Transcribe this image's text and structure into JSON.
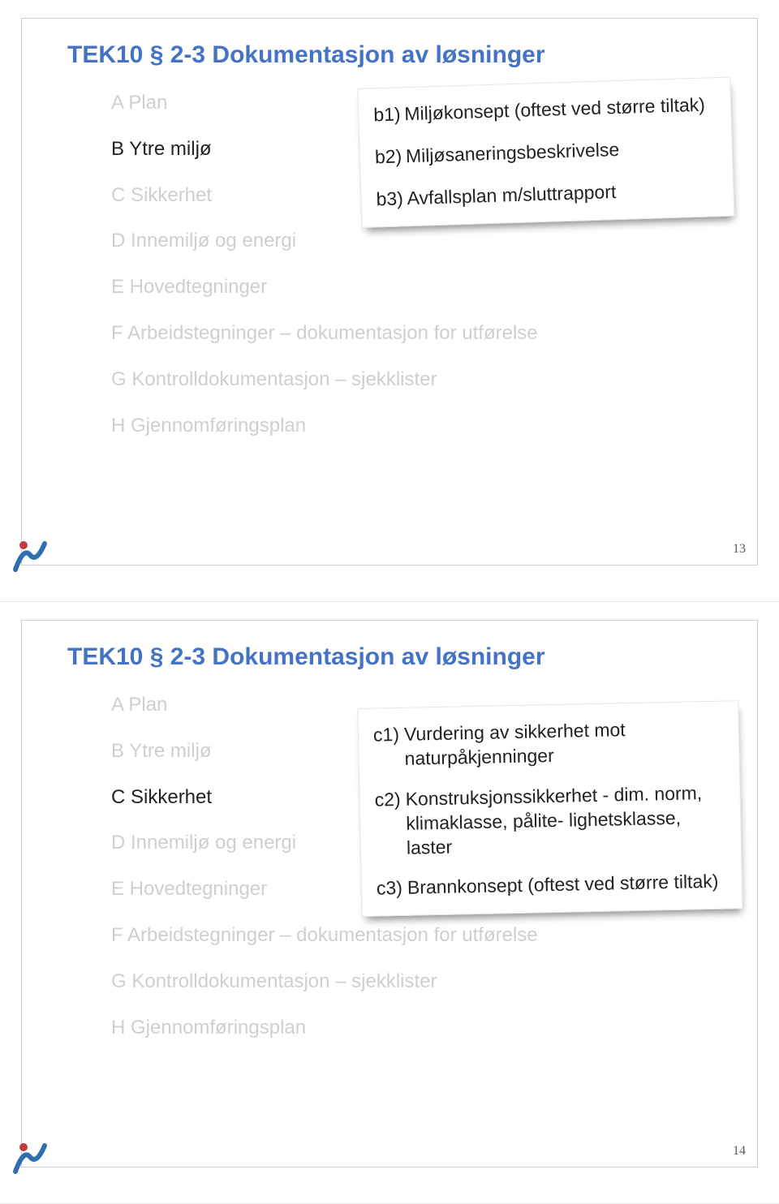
{
  "slide13": {
    "title": "TEK10 § 2-3 Dokumentasjon av løsninger",
    "pageNumber": "13",
    "items": {
      "a": "A Plan",
      "b": "B Ytre miljø",
      "c": "C Sikkerhet",
      "d": "D Innemiljø og energi",
      "e": "E Hovedtegninger",
      "f": "F Arbeidstegninger – dokumentasjon for utførelse",
      "g": "G Kontrolldokumentasjon – sjekklister",
      "h": "H Gjennomføringsplan"
    },
    "note": {
      "b1": {
        "tag": "b1)",
        "text": "Miljøkonsept (oftest ved større tiltak)"
      },
      "b2": {
        "tag": "b2)",
        "text": "Miljøsaneringsbeskrivelse"
      },
      "b3": {
        "tag": "b3)",
        "text": "Avfallsplan m/sluttrapport"
      }
    }
  },
  "slide14": {
    "title": "TEK10 § 2-3 Dokumentasjon av løsninger",
    "pageNumber": "14",
    "items": {
      "a": "A Plan",
      "b": "B Ytre miljø",
      "c": "C Sikkerhet",
      "d": "D Innemiljø og energi",
      "e": "E Hovedtegninger",
      "f": "F Arbeidstegninger – dokumentasjon for utførelse",
      "g": "G Kontrolldokumentasjon – sjekklister",
      "h": "H Gjennomføringsplan"
    },
    "note": {
      "c1": {
        "tag": "c1)",
        "text": "Vurdering av sikkerhet mot naturpåkjenninger"
      },
      "c2": {
        "tag": "c2)",
        "text": "Konstruksjonssikkerhet - dim. norm, klimaklasse, pålite- lighetsklasse, laster"
      },
      "c3": {
        "tag": "c3)",
        "text": "Brannkonsept (oftest ved større tiltak)"
      }
    }
  }
}
